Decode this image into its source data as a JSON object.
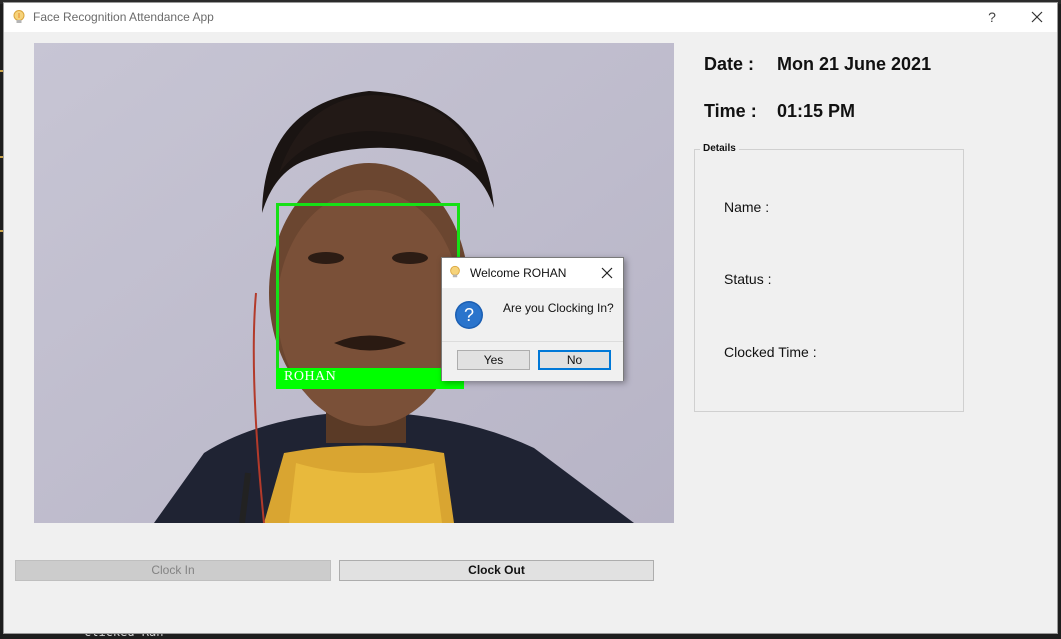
{
  "window": {
    "title": "Face Recognition Attendance App",
    "help_label": "?",
    "icons": {
      "app": "lightbulb-icon",
      "close": "close-icon"
    }
  },
  "camera": {
    "detected_name": "ROHAN",
    "box_color": "#16e016"
  },
  "info": {
    "date_label": "Date :",
    "date_value": "Mon 21 June 2021",
    "time_label": "Time :",
    "time_value": "01:15 PM"
  },
  "details": {
    "group_title": "Details",
    "name_label": "Name :",
    "status_label": "Status :",
    "clocked_label": "Clocked Time :"
  },
  "buttons": {
    "clock_in": "Clock In",
    "clock_out": "Clock Out"
  },
  "dialog": {
    "title": "Welcome ROHAN",
    "message": "Are you Clocking In?",
    "yes_label": "Yes",
    "no_label": "No",
    "icons": {
      "title": "lightbulb-icon",
      "question": "question-icon",
      "close": "close-icon"
    },
    "accent": "#0078d7"
  },
  "background": {
    "terminal_text": "clicked Ran"
  }
}
